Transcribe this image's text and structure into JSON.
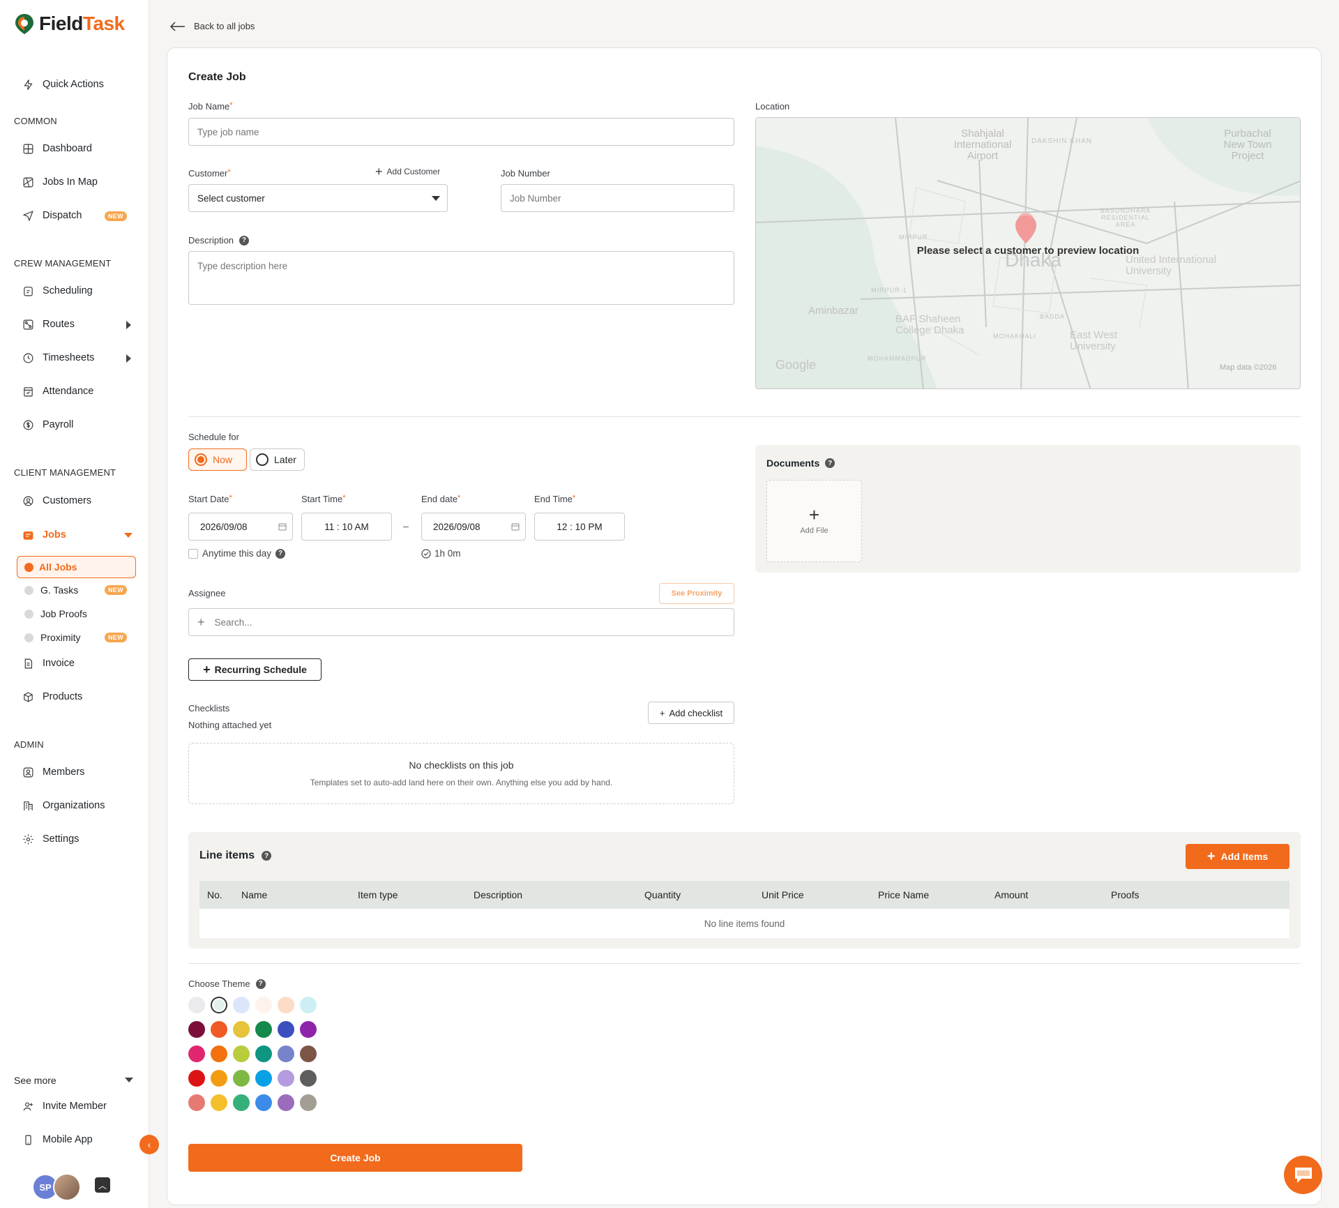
{
  "brand": {
    "name_part1": "Field",
    "name_part2": "Task"
  },
  "sidebar": {
    "quick_actions": "Quick Actions",
    "sections": {
      "common": "COMMON",
      "crew": "CREW MANAGEMENT",
      "client": "CLIENT MANAGEMENT",
      "admin": "ADMIN"
    },
    "items": {
      "dashboard": "Dashboard",
      "jobs_in_map": "Jobs In Map",
      "dispatch": "Dispatch",
      "scheduling": "Scheduling",
      "routes": "Routes",
      "timesheets": "Timesheets",
      "attendance": "Attendance",
      "payroll": "Payroll",
      "customers": "Customers",
      "jobs": "Jobs",
      "all_jobs": "All Jobs",
      "g_tasks": "G. Tasks",
      "job_proofs": "Job Proofs",
      "proximity": "Proximity",
      "invoice": "Invoice",
      "products": "Products",
      "members": "Members",
      "organizations": "Organizations",
      "settings": "Settings"
    },
    "badge_new": "NEW",
    "see_more": "See more",
    "invite_member": "Invite Member",
    "mobile_app": "Mobile App",
    "avatar_initials": "SP",
    "accent_color": "#f26a1b"
  },
  "header": {
    "back_label": "Back to all jobs"
  },
  "form": {
    "title": "Create Job",
    "job_name_label": "Job Name",
    "job_name_placeholder": "Type job name",
    "customer_label": "Customer",
    "add_customer": "Add Customer",
    "customer_select": "Select customer",
    "job_number_label": "Job Number",
    "job_number_placeholder": "Job Number",
    "description_label": "Description",
    "description_placeholder": "Type description here",
    "location_label": "Location",
    "map_message": "Please select a customer to preview location",
    "map_google": "Google",
    "map_credit": "Map data ©2026",
    "map_places": [
      "Shahjalal International Airport",
      "DAKSHIN KHAN",
      "Purbachal New Town Project",
      "BASUNDHARA RESIDENTIAL AREA",
      "MIRPUR",
      "Dhaka",
      "United International University",
      "MIRPUR-1",
      "Aminbazar",
      "BAF Shaheen College Dhaka",
      "BADDA",
      "MOHAKHALI",
      "East West University",
      "MOHAMMADPUR"
    ],
    "schedule_label": "Schedule for",
    "schedule_now": "Now",
    "schedule_later": "Later",
    "start_date_label": "Start Date",
    "start_date": "2026/09/08",
    "start_time_label": "Start Time",
    "start_time": "11 : 10  AM",
    "end_date_label": "End date",
    "end_date": "2026/09/08",
    "end_time_label": "End Time",
    "end_time": "12 : 10  PM",
    "dash": "–",
    "anytime": "Anytime this day",
    "duration": "1h 0m",
    "assignee_label": "Assignee",
    "see_proximity": "See Proximity",
    "assignee_placeholder": "Search...",
    "recurring": "Recurring Schedule",
    "documents_label": "Documents",
    "add_file": "Add File",
    "checklists_label": "Checklists",
    "checklists_empty": "Nothing attached yet",
    "add_checklist": "Add checklist",
    "no_checklists_title": "No checklists on this job",
    "no_checklists_text": "Templates set to auto-add land here on their own. Anything else you add by hand.",
    "line_items_label": "Line items",
    "add_items": "Add Items",
    "columns": [
      "No.",
      "Name",
      "Item type",
      "Description",
      "Quantity",
      "Unit Price",
      "Price Name",
      "Amount",
      "Proofs"
    ],
    "no_line_items": "No line items found",
    "theme_label": "Choose Theme",
    "theme_colors": [
      [
        "#ebebed",
        "#e3f0ee",
        "#dce6fb",
        "#fdf2ec",
        "#fcdcc6",
        "#cdeff3"
      ],
      [
        "#7b0f3a",
        "#f05a24",
        "#e6c33a",
        "#14894a",
        "#3b4fbf",
        "#8e24aa"
      ],
      [
        "#e0266f",
        "#f3700f",
        "#b9cc3b",
        "#0f9683",
        "#7784cc",
        "#7c5547"
      ],
      [
        "#dc1414",
        "#f39c12",
        "#7db843",
        "#0aa0e6",
        "#b49be0",
        "#5e5e5e"
      ],
      [
        "#e67a73",
        "#f5bf2c",
        "#35b07a",
        "#3d8be8",
        "#9b6bbc",
        "#a39e94"
      ]
    ],
    "create_button": "Create Job"
  }
}
